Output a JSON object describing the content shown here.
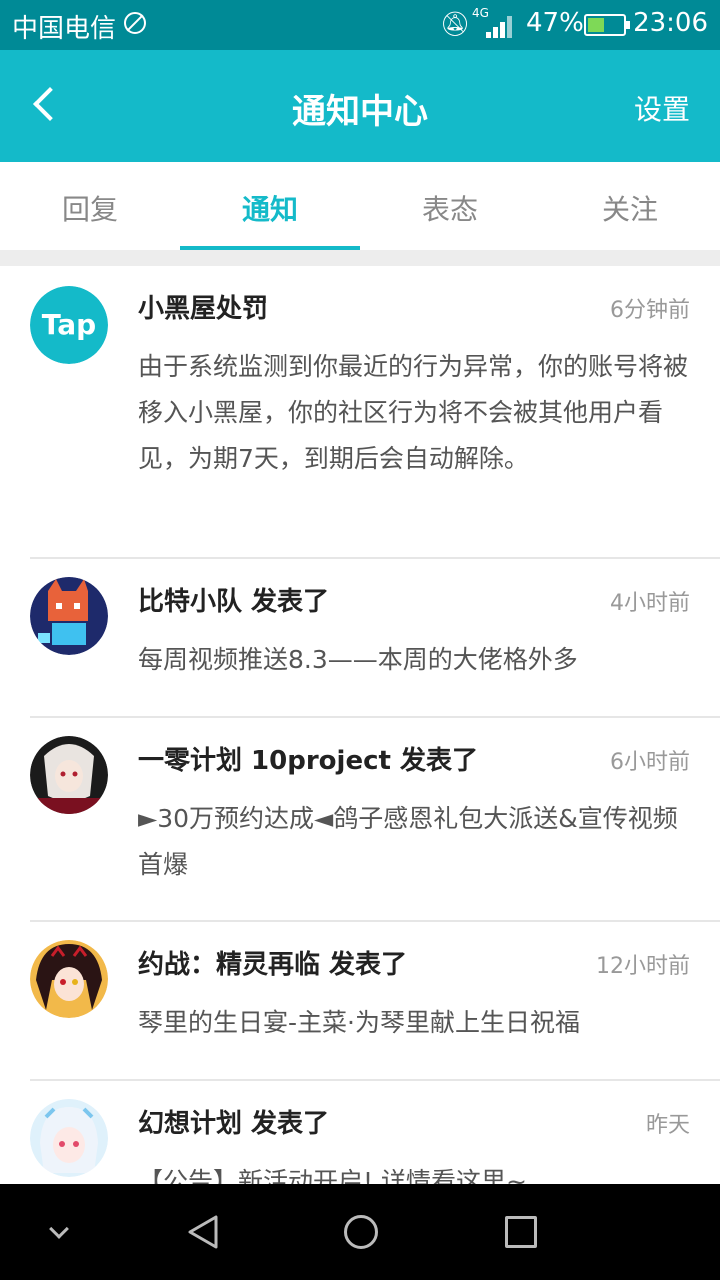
{
  "status_bar": {
    "carrier": "中国电信",
    "network": "4G",
    "battery": "47%",
    "battery_level": 0.47,
    "time": "23:06"
  },
  "header": {
    "title": "通知中心",
    "settings_label": "设置"
  },
  "tabs": [
    {
      "label": "回复",
      "active": false
    },
    {
      "label": "通知",
      "active": true
    },
    {
      "label": "表态",
      "active": false
    },
    {
      "label": "关注",
      "active": false
    }
  ],
  "notifications": [
    {
      "avatar": "tap-logo",
      "avatar_text": "Tap",
      "title": "小黑屋处罚",
      "time": "6分钟前",
      "body": "由于系统监测到你最近的行为异常，你的账号将被移入小黑屋，你的社区行为将不会被其他用户看见，为期7天，到期后会自动解除。"
    },
    {
      "avatar": "bit-squad-avatar",
      "title": "比特小队 发表了",
      "time": "4小时前",
      "body": "每周视频推送8.3——本周的大佬格外多"
    },
    {
      "avatar": "10project-avatar",
      "title": "一零计划 10project 发表了",
      "time": "6小时前",
      "body": "►30万预约达成◄鸽子感恩礼包大派送&宣传视频首爆"
    },
    {
      "avatar": "date-a-live-avatar",
      "title": "约战：精灵再临 发表了",
      "time": "12小时前",
      "body": "琴里的生日宴-主菜·为琴里献上生日祝福"
    },
    {
      "avatar": "fantasy-plan-avatar",
      "title": "幻想计划 发表了",
      "time": "昨天",
      "body": "【公告】新活动开启! 详情看这里~"
    }
  ],
  "colors": {
    "accent": "#14bac9",
    "status_bar": "#008a96"
  }
}
